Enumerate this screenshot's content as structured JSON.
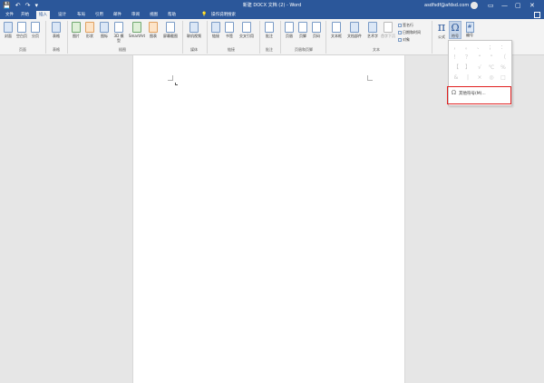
{
  "titlebar": {
    "title": "新建 DOCX 文档 (2)  -  Word",
    "account": "asdfsdf@afdsd.com",
    "qat": [
      "💾",
      "↶",
      "↷",
      "▾"
    ],
    "window_controls": [
      "▭",
      "—",
      "▢",
      "✕"
    ]
  },
  "tabs": [
    {
      "label": "文件"
    },
    {
      "label": "开始"
    },
    {
      "label": "插入"
    },
    {
      "label": "设计"
    },
    {
      "label": "布局"
    },
    {
      "label": "引用"
    },
    {
      "label": "邮件"
    },
    {
      "label": "审阅"
    },
    {
      "label": "视图"
    },
    {
      "label": "帮助"
    }
  ],
  "tell_me": "操作说明搜索",
  "ribbon": {
    "buttons": {
      "cover": "封面",
      "blank": "空白页",
      "pagebreak": "分页",
      "table": "表格",
      "picture": "图片",
      "shapes": "形状",
      "icons": "图标",
      "model3d": "3D 模型",
      "smartart": "SmartArt",
      "chart": "图表",
      "screenshot": "屏幕截图",
      "onlinevideo": "联机视频",
      "link": "链接",
      "bookmark": "书签",
      "crossref": "交叉引用",
      "comment": "批注",
      "header": "页眉",
      "footer": "页脚",
      "pagenum": "页码",
      "textbox": "文本框",
      "quickparts": "文档部件",
      "wordart": "艺术字",
      "dropcap": "首字下沉",
      "signature": "签名行",
      "datetime": "日期和时间",
      "object": "对象",
      "equation": "公式",
      "symbol": "符号",
      "number": "编号"
    },
    "groups": {
      "pages": "页面",
      "tables": "表格",
      "illustrations": "插图",
      "media": "媒体",
      "links": "链接",
      "comments": "批注",
      "headerfooter": "页眉和页脚",
      "text": "文本"
    }
  },
  "symbol_menu": {
    "symbols": [
      "，",
      "。",
      "、",
      "；",
      "：",
      "！",
      "？",
      "“",
      "”",
      "（",
      "【",
      "】",
      "√",
      "℃",
      "%",
      "&",
      "|",
      "×",
      "◎",
      "□"
    ],
    "more_symbols": "其他符号(M)..."
  },
  "colors": {
    "word_blue": "#2b579a",
    "highlight_red": "#e02020"
  }
}
